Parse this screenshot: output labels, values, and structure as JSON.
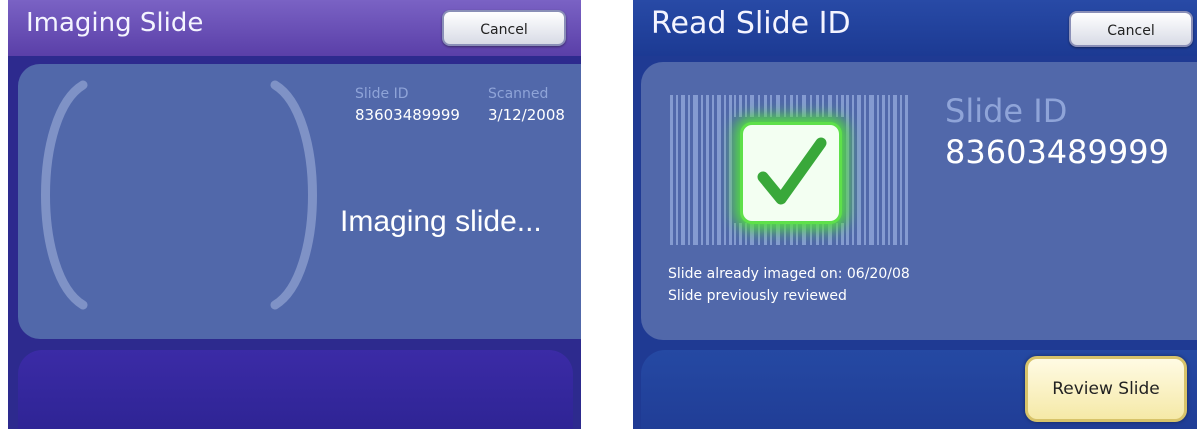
{
  "imaging_screen": {
    "title": "Imaging Slide",
    "cancel_label": "Cancel",
    "slide_id_label": "Slide ID",
    "slide_id_value": "83603489999",
    "scanned_label": "Scanned",
    "scanned_value": "3/12/2008",
    "status_text": "Imaging slide..."
  },
  "read_screen": {
    "title": "Read Slide ID",
    "cancel_label": "Cancel",
    "slide_id_label": "Slide ID",
    "slide_id_value": "83603489999",
    "status_lines": [
      "Slide already imaged on: 06/20/08",
      "Slide previously reviewed"
    ],
    "review_button_label": "Review Slide"
  },
  "colors": {
    "panel": "#5168aa",
    "check_green": "#39a83a",
    "glow": "#54e03f"
  },
  "icons": [
    "barcode-icon",
    "checkmark-icon"
  ]
}
